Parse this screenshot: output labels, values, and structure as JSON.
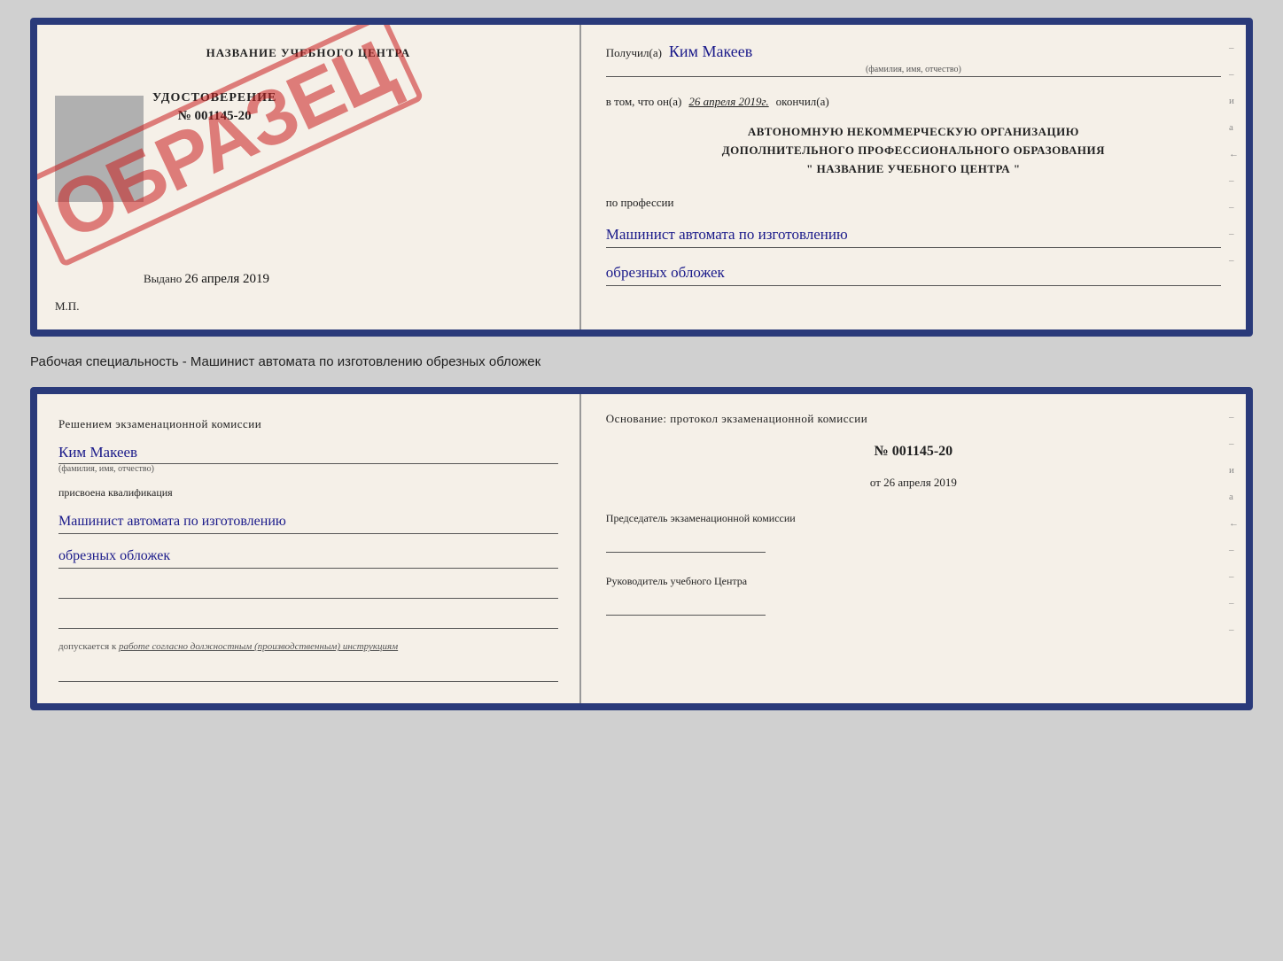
{
  "top_doc": {
    "left": {
      "header": "НАЗВАНИЕ УЧЕБНОГО ЦЕНТРА",
      "udostoverenie_title": "УДОСТОВЕРЕНИЕ",
      "udostoverenie_number": "№ 001145-20",
      "stamp_text": "ОБРАЗЕЦ",
      "vydano_label": "Выдано",
      "vydano_date": "26 апреля 2019",
      "mp_label": "М.П."
    },
    "right": {
      "poluchil_label": "Получил(a)",
      "recipient_name": "Ким Макеев",
      "fio_sub": "(фамилия, имя, отчество)",
      "v_tom_label": "в том, что он(а)",
      "date_value": "26 апреля 2019г.",
      "okonchil_label": "окончил(а)",
      "org_line1": "АВТОНОМНУЮ НЕКОММЕРЧЕСКУЮ ОРГАНИЗАЦИЮ",
      "org_line2": "ДОПОЛНИТЕЛЬНОГО ПРОФЕССИОНАЛЬНОГО ОБРАЗОВАНИЯ",
      "org_line3": "\"    НАЗВАНИЕ УЧЕБНОГО ЦЕНТРА    \"",
      "profession_label": "по профессии",
      "profession_hand1": "Машинист автомата по изготовлению",
      "profession_hand2": "обрезных обложек"
    }
  },
  "middle_label": "Рабочая специальность - Машинист автомата по изготовлению обрезных обложек",
  "bottom_doc": {
    "left": {
      "resheniem_label": "Решением экзаменационной комиссии",
      "person_name": "Ким Макеев",
      "fio_sub": "(фамилия, имя, отчество)",
      "prisvoena_label": "присвоена квалификация",
      "kvali_hand1": "Машинист автомата по изготовлению",
      "kvali_hand2": "обрезных обложек",
      "dopusk_label": "допускается к",
      "dopusk_text": "работе согласно должностным (производственным) инструкциям"
    },
    "right": {
      "osnov_label": "Основание: протокол экзаменационной комиссии",
      "protocol_num": "№  001145-20",
      "from_label": "от",
      "from_date": "26 апреля 2019",
      "chairman_label": "Председатель экзаменационной комиссии",
      "rukovod_label": "Руководитель учебного Центра"
    }
  },
  "edge_marks": [
    "-",
    "-",
    "-",
    "и",
    "а",
    "←",
    "-",
    "-",
    "-",
    "-"
  ]
}
